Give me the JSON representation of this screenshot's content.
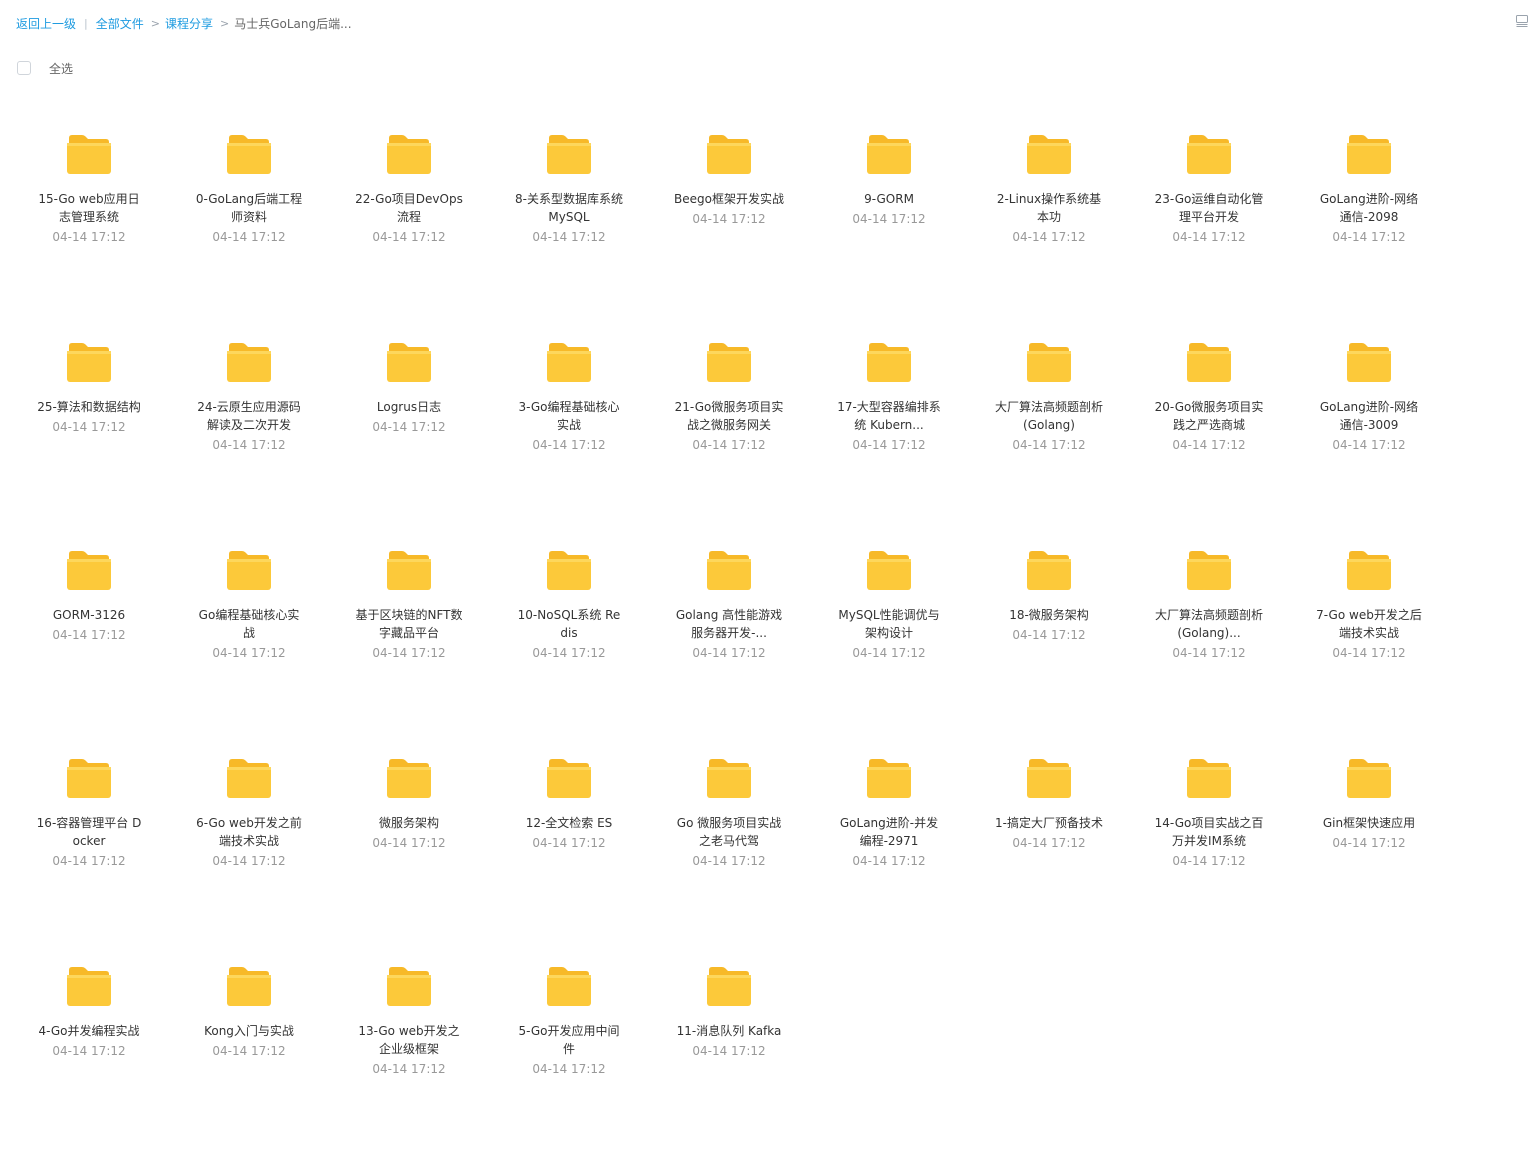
{
  "breadcrumb": {
    "back": "返回上一级",
    "all_files": "全部文件",
    "course_share": "课程分享",
    "current": "马士兵GoLang后端..."
  },
  "toolbar": {
    "select_all": "全选",
    "view_icon": "list-view-icon"
  },
  "colors": {
    "link": "#1e9be0",
    "folder_body": "#fcc93a",
    "folder_tab": "#f7b928",
    "time_text": "#999999"
  },
  "files": [
    {
      "name": "15-Go web应用日志管理系统",
      "time": "04-14 17:12"
    },
    {
      "name": "0-GoLang后端工程师资料",
      "time": "04-14 17:12"
    },
    {
      "name": "22-Go项目DevOps流程",
      "time": "04-14 17:12"
    },
    {
      "name": "8-关系型数据库系统 MySQL",
      "time": "04-14 17:12"
    },
    {
      "name": "Beego框架开发实战",
      "time": "04-14 17:12"
    },
    {
      "name": "9-GORM",
      "time": "04-14 17:12"
    },
    {
      "name": "2-Linux操作系统基本功",
      "time": "04-14 17:12"
    },
    {
      "name": "23-Go运维自动化管理平台开发",
      "time": "04-14 17:12"
    },
    {
      "name": "GoLang进阶-网络通信-2098",
      "time": "04-14 17:12"
    },
    {
      "name": "25-算法和数据结构",
      "time": "04-14 17:12"
    },
    {
      "name": "24-云原生应用源码解读及二次开发",
      "time": "04-14 17:12"
    },
    {
      "name": "Logrus日志",
      "time": "04-14 17:12"
    },
    {
      "name": "3-Go编程基础核心实战",
      "time": "04-14 17:12"
    },
    {
      "name": "21-Go微服务项目实战之微服务网关",
      "time": "04-14 17:12"
    },
    {
      "name": "17-大型容器编排系统 Kubern...",
      "time": "04-14 17:12"
    },
    {
      "name": "大厂算法高频题剖析 (Golang)",
      "time": "04-14 17:12"
    },
    {
      "name": "20-Go微服务项目实践之严选商城",
      "time": "04-14 17:12"
    },
    {
      "name": "GoLang进阶-网络通信-3009",
      "time": "04-14 17:12"
    },
    {
      "name": "GORM-3126",
      "time": "04-14 17:12"
    },
    {
      "name": "Go编程基础核心实战",
      "time": "04-14 17:12"
    },
    {
      "name": "基于区块链的NFT数字藏品平台",
      "time": "04-14 17:12"
    },
    {
      "name": "10-NoSQL系统 Redis",
      "time": "04-14 17:12"
    },
    {
      "name": "Golang 高性能游戏服务器开发-...",
      "time": "04-14 17:12"
    },
    {
      "name": "MySQL性能调优与架构设计",
      "time": "04-14 17:12"
    },
    {
      "name": "18-微服务架构",
      "time": "04-14 17:12"
    },
    {
      "name": "大厂算法高频题剖析 (Golang)...",
      "time": "04-14 17:12"
    },
    {
      "name": "7-Go web开发之后端技术实战",
      "time": "04-14 17:12"
    },
    {
      "name": "16-容器管理平台 Docker",
      "time": "04-14 17:12"
    },
    {
      "name": "6-Go web开发之前端技术实战",
      "time": "04-14 17:12"
    },
    {
      "name": "微服务架构",
      "time": "04-14 17:12"
    },
    {
      "name": "12-全文检索 ES",
      "time": "04-14 17:12"
    },
    {
      "name": "Go 微服务项目实战之老马代驾",
      "time": "04-14 17:12"
    },
    {
      "name": "GoLang进阶-并发编程-2971",
      "time": "04-14 17:12"
    },
    {
      "name": "1-搞定大厂预备技术",
      "time": "04-14 17:12"
    },
    {
      "name": "14-Go项目实战之百万并发IM系统",
      "time": "04-14 17:12"
    },
    {
      "name": "Gin框架快速应用",
      "time": "04-14 17:12"
    },
    {
      "name": "4-Go并发编程实战",
      "time": "04-14 17:12"
    },
    {
      "name": "Kong入门与实战",
      "time": "04-14 17:12"
    },
    {
      "name": "13-Go web开发之企业级框架",
      "time": "04-14 17:12"
    },
    {
      "name": "5-Go开发应用中间件",
      "time": "04-14 17:12"
    },
    {
      "name": "11-消息队列 Kafka",
      "time": "04-14 17:12"
    }
  ]
}
